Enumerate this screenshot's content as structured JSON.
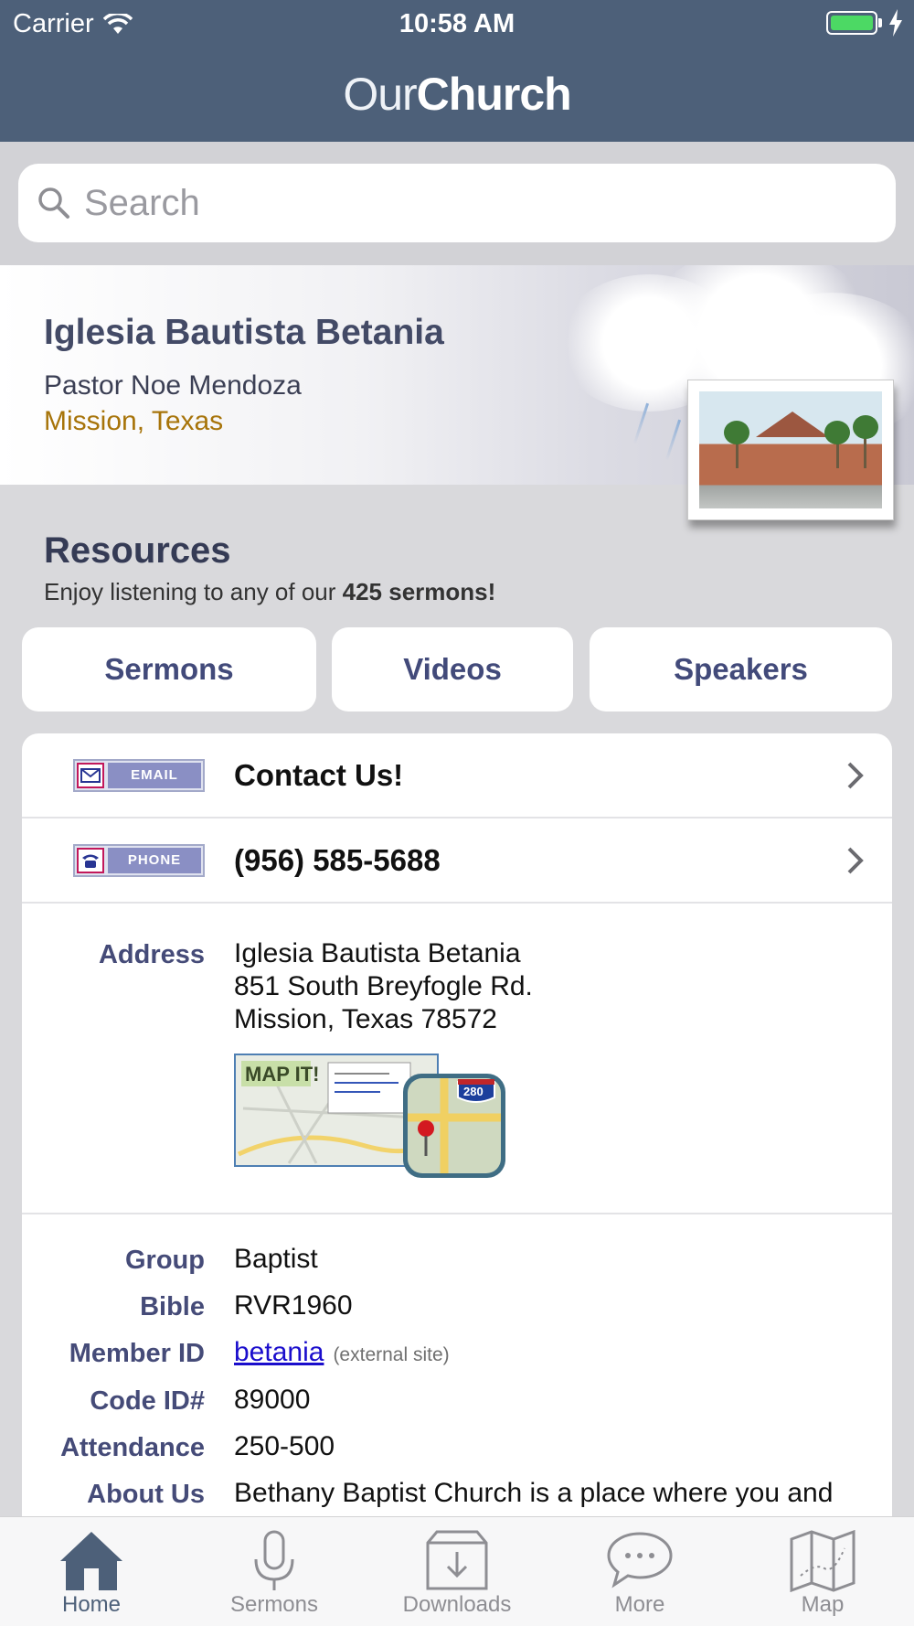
{
  "status_bar": {
    "carrier": "Carrier",
    "time": "10:58 AM"
  },
  "app": {
    "title_light": "Our",
    "title_bold": "Church"
  },
  "search": {
    "placeholder": "Search"
  },
  "church": {
    "name": "Iglesia Bautista Betania",
    "pastor": "Pastor Noe Mendoza",
    "location": "Mission, Texas"
  },
  "resources": {
    "title": "Resources",
    "subtitle_prefix": "Enjoy listening to any of our ",
    "subtitle_bold": "425 sermons!",
    "buttons": [
      "Sermons",
      "Videos",
      "Speakers"
    ]
  },
  "contact": {
    "email_badge": "EMAIL",
    "email_label": "Contact Us!",
    "phone_badge": "PHONE",
    "phone_label": "(956) 585-5688"
  },
  "address": {
    "label": "Address",
    "lines": [
      "Iglesia Bautista Betania",
      "851 South Breyfogle Rd.",
      "Mission, Texas 78572"
    ],
    "map_button": "MAP IT!",
    "map_shield": "280"
  },
  "details": {
    "group_label": "Group",
    "group_value": "Baptist",
    "bible_label": "Bible",
    "bible_value": "RVR1960",
    "member_label": "Member ID",
    "member_value": "betania",
    "member_note": "(external site)",
    "code_label": "Code ID#",
    "code_value": "89000",
    "attendance_label": "Attendance",
    "attendance_value": "250-500",
    "about_label": "About Us",
    "about_value": "Bethany Baptist Church is a place where you and"
  },
  "tabs": [
    {
      "label": "Home",
      "icon": "home-icon",
      "active": true
    },
    {
      "label": "Sermons",
      "icon": "microphone-icon",
      "active": false
    },
    {
      "label": "Downloads",
      "icon": "download-box-icon",
      "active": false
    },
    {
      "label": "More",
      "icon": "chat-bubble-icon",
      "active": false
    },
    {
      "label": "Map",
      "icon": "map-icon",
      "active": false
    }
  ],
  "colors": {
    "nav": "#4d6079",
    "label": "#454b78",
    "location": "#a7740a",
    "link": "#1a0dcc"
  }
}
